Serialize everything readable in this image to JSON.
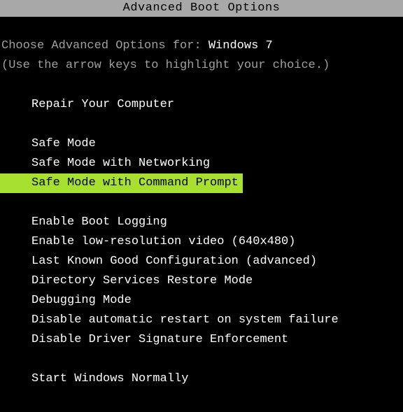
{
  "title": "Advanced Boot Options",
  "prompt_prefix": "Choose Advanced Options for: ",
  "os_name": "Windows 7",
  "instruction": "(Use the arrow keys to highlight your choice.)",
  "menu": {
    "group1": [
      "Repair Your Computer"
    ],
    "group2": [
      "Safe Mode",
      "Safe Mode with Networking",
      "Safe Mode with Command Prompt"
    ],
    "group3": [
      "Enable Boot Logging",
      "Enable low-resolution video (640x480)",
      "Last Known Good Configuration (advanced)",
      "Directory Services Restore Mode",
      "Debugging Mode",
      "Disable automatic restart on system failure",
      "Disable Driver Signature Enforcement"
    ],
    "group4": [
      "Start Windows Normally"
    ]
  },
  "selected_index": 3
}
